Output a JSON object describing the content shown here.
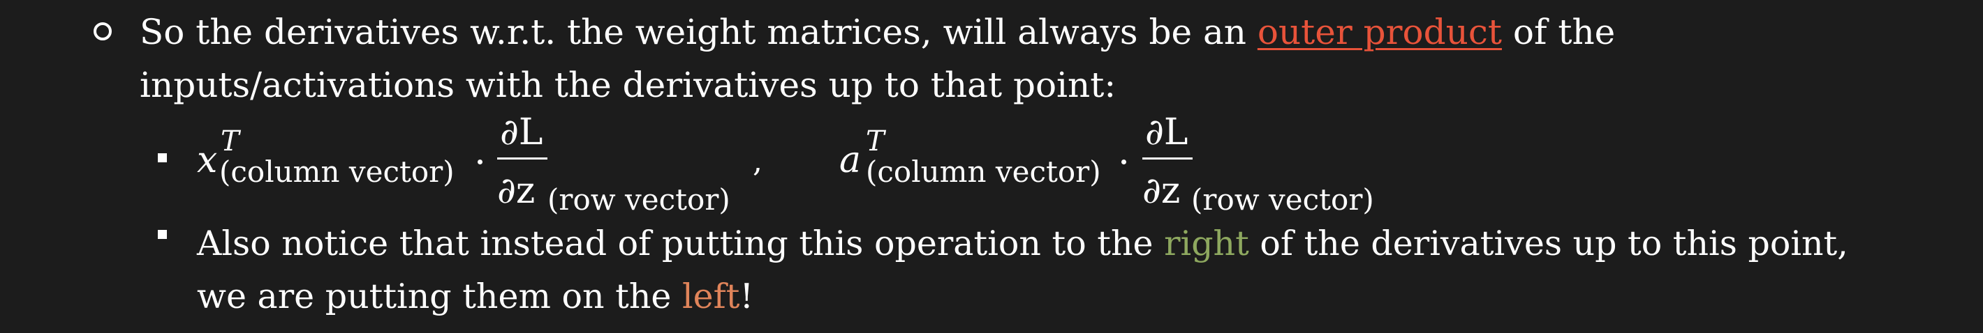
{
  "line1": {
    "before": "So the derivatives w.r.t. the weight matrices, will always be an ",
    "link": "outer product",
    "after": " of the"
  },
  "line2": "inputs/activations with the derivatives up to that point:",
  "formula": {
    "x": "x",
    "x_sup": "T",
    "x_sub": "(column vector)",
    "frac1_num": "∂L",
    "frac1_den": "∂z",
    "frac1_sub": "(row vector)",
    "comma": ",",
    "a": "a",
    "a_sup": "T",
    "a_sub": "(column vector)",
    "frac2_num": "∂L",
    "frac2_den": "∂z",
    "frac2_sub": "(row vector)"
  },
  "line4": {
    "before": "Also notice that instead of putting this operation to the ",
    "green_word": "right",
    "after": " of the derivatives up to this point,"
  },
  "line5": {
    "before": "we are putting them on the ",
    "orange_word": "left",
    "after": "!"
  },
  "colors": {
    "background": "#1c1c1c",
    "text": "#ffffff",
    "link_red": "#e8533a",
    "green": "#8ea85f",
    "orange": "#e0845a"
  }
}
